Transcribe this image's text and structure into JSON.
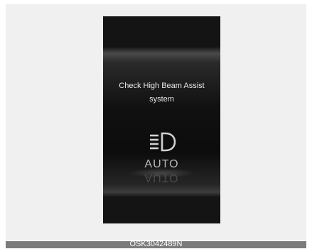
{
  "display": {
    "message_line1": "Check High Beam Assist",
    "message_line2": "system",
    "icon": "high-beam-headlamp-icon",
    "mode_label": "AUTO"
  },
  "caption": {
    "code": "OSK3042489N"
  }
}
